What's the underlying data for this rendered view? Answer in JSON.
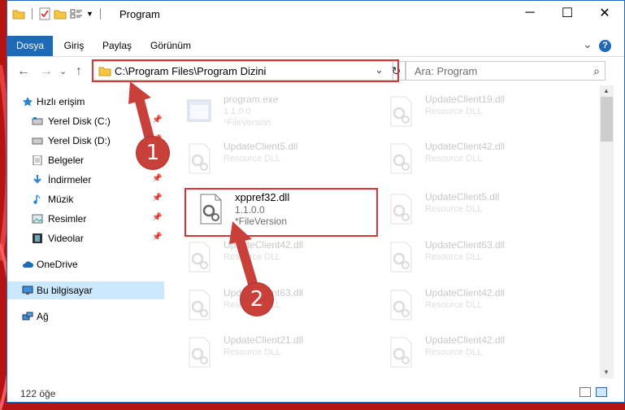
{
  "titlebar": {
    "title": "Program",
    "minimize_glyph": "─",
    "maximize_glyph": "☐",
    "close_glyph": "✕"
  },
  "ribbon": {
    "tabs": [
      {
        "label": "Dosya",
        "active": true
      },
      {
        "label": "Giriş",
        "active": false
      },
      {
        "label": "Paylaş",
        "active": false
      },
      {
        "label": "Görünüm",
        "active": false
      }
    ],
    "collapse_glyph": "⌄",
    "help_glyph": "?"
  },
  "nav": {
    "back_glyph": "←",
    "forward_glyph": "→",
    "dropdown_glyph": "⌄",
    "up_glyph": "↑",
    "address": "C:\\Program Files\\Program Dizini",
    "address_dropdown_glyph": "⌄",
    "refresh_glyph": "↻",
    "search_placeholder": "Ara: Program",
    "search_glyph": "⌕"
  },
  "sidebar": {
    "items": [
      {
        "label": "Hızlı erişim",
        "icon": "star-icon",
        "pinned": false
      },
      {
        "label": "Yerel Disk (C:)",
        "icon": "drive-icon",
        "pinned": true
      },
      {
        "label": "Yerel Disk (D:)",
        "icon": "drive-icon",
        "pinned": true
      },
      {
        "label": "Belgeler",
        "icon": "document-icon",
        "pinned": true
      },
      {
        "label": "İndirmeler",
        "icon": "download-icon",
        "pinned": true
      },
      {
        "label": "Müzik",
        "icon": "music-icon",
        "pinned": true
      },
      {
        "label": "Resimler",
        "icon": "picture-icon",
        "pinned": true
      },
      {
        "label": "Videolar",
        "icon": "video-icon",
        "pinned": true
      },
      {
        "label": "OneDrive",
        "icon": "cloud-icon",
        "pinned": false
      },
      {
        "label": "Bu bilgisayar",
        "icon": "computer-icon",
        "pinned": false,
        "selected": true
      },
      {
        "label": "Ağ",
        "icon": "network-icon",
        "pinned": false
      }
    ],
    "pin_glyph": "📌"
  },
  "files": [
    {
      "name": "program.exe",
      "line2": "1.1.0.0",
      "line3": "*FileVersion"
    },
    {
      "name": "UpdateClient19.dll",
      "line2": "Resource DLL",
      "line3": ""
    },
    {
      "name": "UpdateClient5.dll",
      "line2": "Resource DLL",
      "line3": ""
    },
    {
      "name": "UpdateClient42.dll",
      "line2": "Resource DLL",
      "line3": ""
    },
    {
      "name": "xppref32.dll",
      "line2": "1.1.0.0",
      "line3": "*FileVersion"
    },
    {
      "name": "UpdateClient5.dll",
      "line2": "Resource DLL",
      "line3": ""
    },
    {
      "name": "UpdateClient42.dll",
      "line2": "Resource DLL",
      "line3": ""
    },
    {
      "name": "UpdateClient63.dll",
      "line2": "Resource DLL",
      "line3": ""
    },
    {
      "name": "UpdateClient63.dll",
      "line2": "Resource DLL",
      "line3": ""
    },
    {
      "name": "UpdateClient42.dll",
      "line2": "Resource DLL",
      "line3": ""
    },
    {
      "name": "UpdateClient21.dll",
      "line2": "Resource DLL",
      "line3": ""
    },
    {
      "name": "UpdateClient42.dll",
      "line2": "Resource DLL",
      "line3": ""
    }
  ],
  "status": {
    "item_count": "122 öğe"
  },
  "annotations": {
    "badge1": "1",
    "badge2": "2"
  },
  "colors": {
    "accent": "#1e6ab8",
    "highlight_box": "#d33333",
    "badge": "#c9403a",
    "selected_nav": "#cce8ff"
  }
}
